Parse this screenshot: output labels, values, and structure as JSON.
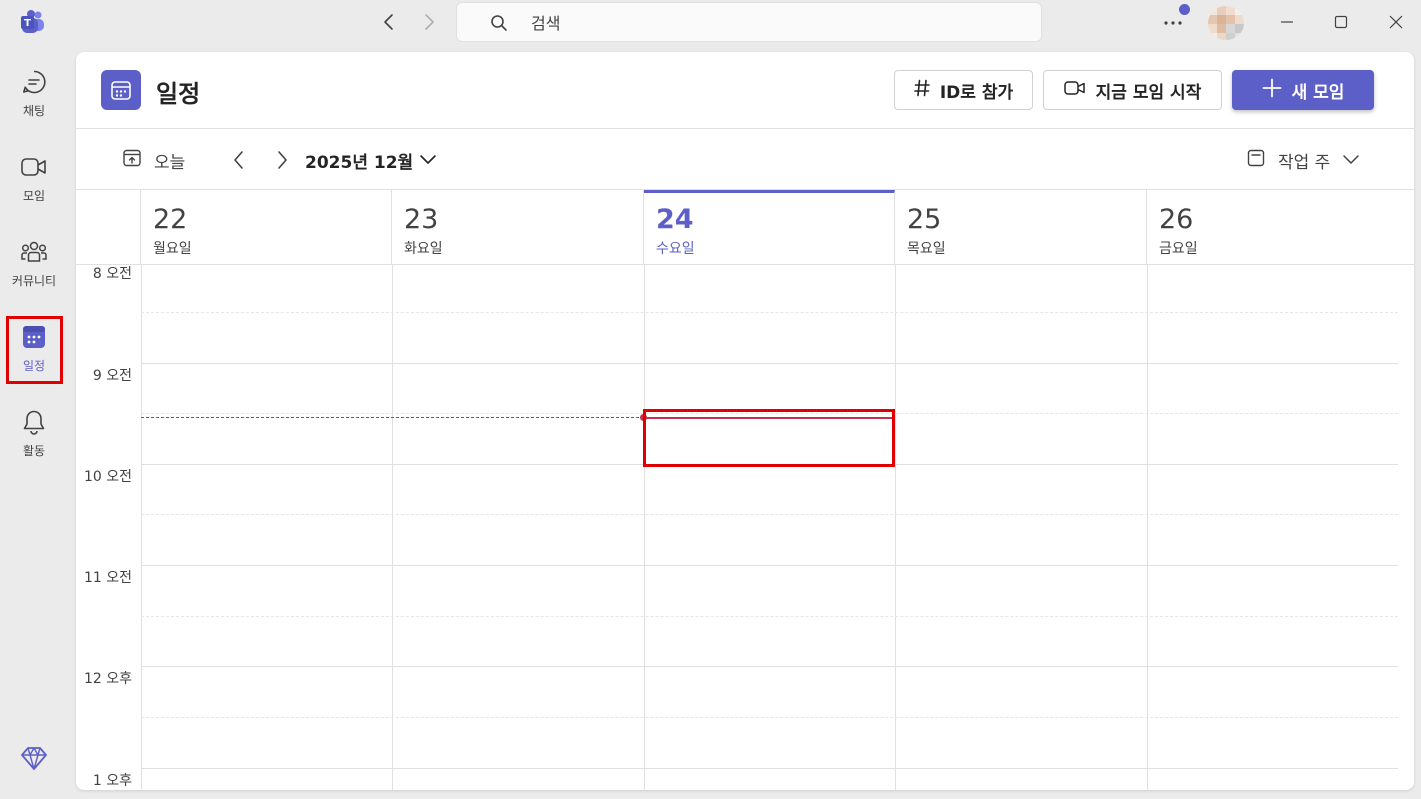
{
  "titlebar": {
    "search_placeholder": "검색",
    "notification_color": "#5b5fc7"
  },
  "rail": {
    "items": [
      {
        "label": "채팅",
        "icon": "chat-icon"
      },
      {
        "label": "모임",
        "icon": "video-icon"
      },
      {
        "label": "커뮤니티",
        "icon": "community-icon"
      },
      {
        "label": "일정",
        "icon": "calendar-icon",
        "active": true
      },
      {
        "label": "활동",
        "icon": "bell-icon"
      }
    ],
    "premium_icon": "diamond-icon"
  },
  "header": {
    "title": "일정",
    "join_id_label": "ID로 참가",
    "meet_now_label": "지금 모임 시작",
    "new_meeting_label": "새 모임",
    "accent_color": "#5b5fc7"
  },
  "toolbar": {
    "today_label": "오늘",
    "month_label": "2025년 12월",
    "view_label": "작업 주"
  },
  "days": [
    {
      "num": "22",
      "name": "월요일"
    },
    {
      "num": "23",
      "name": "화요일"
    },
    {
      "num": "24",
      "name": "수요일",
      "today": true
    },
    {
      "num": "25",
      "name": "목요일"
    },
    {
      "num": "26",
      "name": "금요일"
    }
  ],
  "times": [
    "8 오전",
    "9 오전",
    "10 오전",
    "11 오전",
    "12 오후",
    "1 오후"
  ],
  "now_indicator_color": "#c4314b"
}
